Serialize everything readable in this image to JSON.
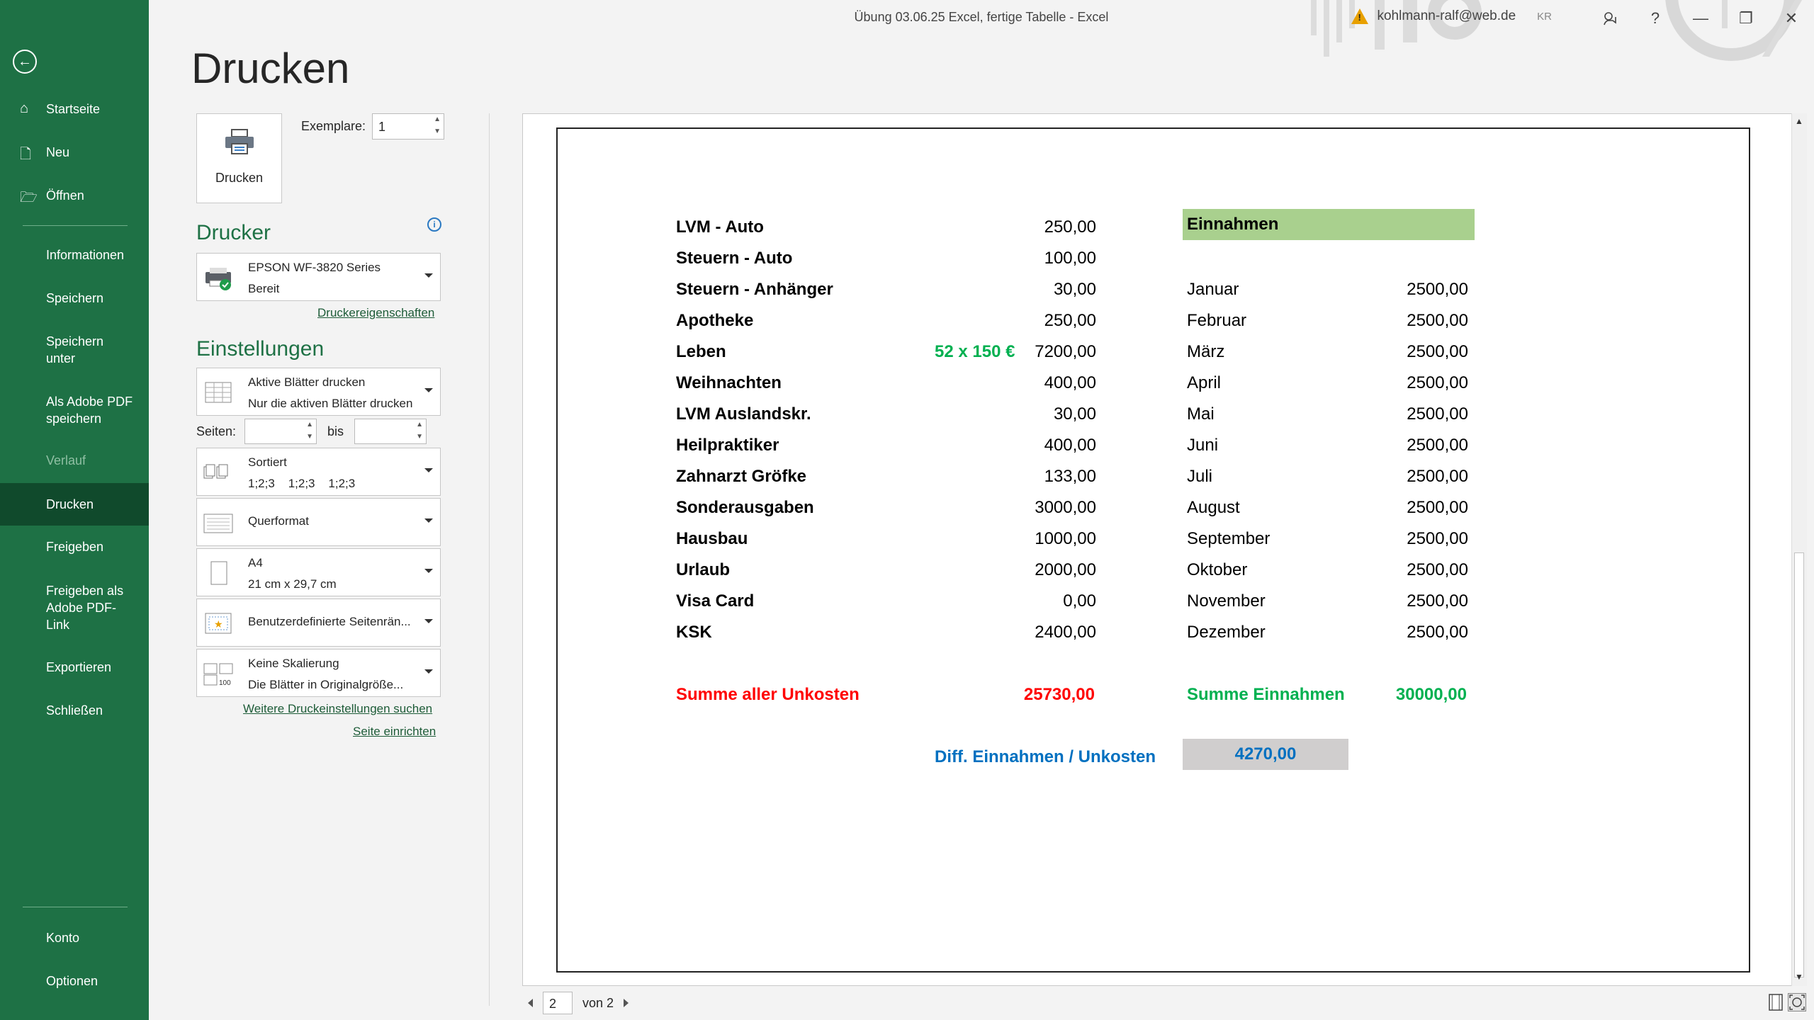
{
  "window": {
    "title": "Übung 03.06.25 Excel, fertige Tabelle  -  Excel",
    "account": "kohlmann-ralf@web.de",
    "initials": "KR",
    "controls": [
      "?",
      "—",
      "❐",
      "✕"
    ]
  },
  "sidebar": {
    "items_top": [
      {
        "icon": "home-icon",
        "label": "Startseite"
      },
      {
        "icon": "new-doc-icon",
        "label": "Neu"
      },
      {
        "icon": "folder-open-icon",
        "label": "Öffnen"
      }
    ],
    "items_middle": [
      {
        "label": "Informationen"
      },
      {
        "label": "Speichern"
      },
      {
        "label": "Speichern unter"
      },
      {
        "label": "Als Adobe PDF speichern"
      },
      {
        "label": "Verlauf"
      },
      {
        "label": "Drucken"
      },
      {
        "label": "Freigeben"
      },
      {
        "label": "Freigeben als Adobe PDF-Link"
      },
      {
        "label": "Exportieren"
      },
      {
        "label": "Schließen"
      }
    ],
    "items_bottom": [
      {
        "label": "Konto"
      },
      {
        "label": "Optionen"
      }
    ]
  },
  "print": {
    "heading": "Drucken",
    "button_label": "Drucken",
    "copies_label": "Exemplare:",
    "copies_value": "1",
    "printer_heading": "Drucker",
    "printer_name": "EPSON WF-3820 Series",
    "printer_status": "Bereit",
    "printer_props_link": "Druckereigenschaften",
    "settings_heading": "Einstellungen",
    "what_title": "Aktive Blätter drucken",
    "what_sub": "Nur die aktiven Blätter drucken",
    "pages_label": "Seiten:",
    "to_label": "bis",
    "collate_title": "Sortiert",
    "collate_sub": "1;2;3    1;2;3    1;2;3",
    "orientation": "Querformat",
    "paper_title": "A4",
    "paper_sub": "21 cm x 29,7 cm",
    "margins": "Benutzerdefinierte Seitenrän...",
    "scaling_title": "Keine Skalierung",
    "scaling_sub": "Die Blätter in Originalgröße...",
    "more_settings_link": "Weitere Druckeinstellungen suchen",
    "page_setup_link": "Seite einrichten"
  },
  "sheet": {
    "expenses": [
      {
        "label": "LVM - Auto",
        "value": "250,00"
      },
      {
        "label": "Steuern - Auto",
        "value": "100,00"
      },
      {
        "label": "Steuern - Anhänger",
        "value": "30,00"
      },
      {
        "label": "Apotheke",
        "value": "250,00"
      },
      {
        "label": "Leben",
        "value": "7200,00",
        "note": "52 x 150 €"
      },
      {
        "label": "Weihnachten",
        "value": "400,00"
      },
      {
        "label": "LVM Auslandskr.",
        "value": "30,00"
      },
      {
        "label": "Heilpraktiker",
        "value": "400,00"
      },
      {
        "label": "Zahnarzt Gröfke",
        "value": "133,00"
      },
      {
        "label": "Sonderausgaben",
        "value": "3000,00"
      },
      {
        "label": "Hausbau",
        "value": "1000,00"
      },
      {
        "label": "Urlaub",
        "value": "2000,00"
      },
      {
        "label": "Visa Card",
        "value": "0,00"
      },
      {
        "label": "KSK",
        "value": "2400,00"
      }
    ],
    "income_header": "Einnahmen",
    "income": [
      {
        "month": "Januar",
        "value": "2500,00"
      },
      {
        "month": "Februar",
        "value": "2500,00"
      },
      {
        "month": "März",
        "value": "2500,00"
      },
      {
        "month": "April",
        "value": "2500,00"
      },
      {
        "month": "Mai",
        "value": "2500,00"
      },
      {
        "month": "Juni",
        "value": "2500,00"
      },
      {
        "month": "Juli",
        "value": "2500,00"
      },
      {
        "month": "August",
        "value": "2500,00"
      },
      {
        "month": "September",
        "value": "2500,00"
      },
      {
        "month": "Oktober",
        "value": "2500,00"
      },
      {
        "month": "November",
        "value": "2500,00"
      },
      {
        "month": "Dezember",
        "value": "2500,00"
      }
    ],
    "sum_expenses_label": "Summe aller Unkosten",
    "sum_expenses_value": "25730,00",
    "sum_income_label": "Summe Einnahmen",
    "sum_income_value": "30000,00",
    "diff_label": "Diff. Einnahmen / Unkosten",
    "diff_value": "4270,00",
    "colors": {
      "income_header_bg": "#a9d08e",
      "red": "#ff0000",
      "green": "#00b050",
      "blue": "#0070c0",
      "diff_bg": "#d0cece"
    }
  },
  "pagenav": {
    "current": "2",
    "of_label": "von 2"
  }
}
